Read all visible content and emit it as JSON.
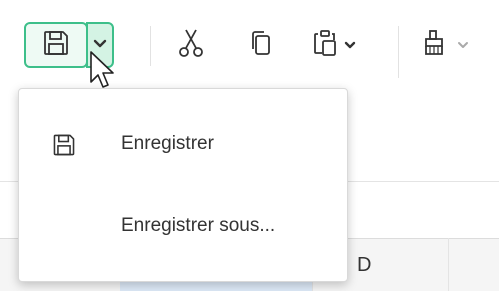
{
  "toolbar": {
    "icons": [
      "save-icon",
      "chevron-down-icon",
      "cut-icon",
      "copy-icon",
      "paste-icon",
      "paste-options-chevron-icon",
      "format-painter-icon",
      "format-painter-chevron-icon"
    ]
  },
  "save_menu": {
    "items": [
      {
        "label": "Enregistrer",
        "icon": "save-icon"
      },
      {
        "label": "Enregistrer sous..."
      }
    ]
  },
  "sheet": {
    "visible_column_header": "D"
  },
  "colors": {
    "accent": "#3dbf8a",
    "selected_column": "#dde9f7"
  }
}
